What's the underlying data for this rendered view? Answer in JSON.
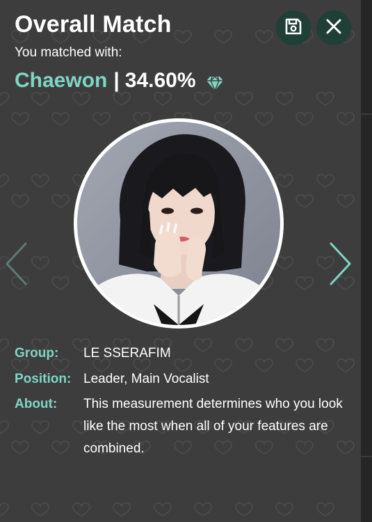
{
  "header": {
    "title": "Overall Match",
    "subtitle": "You matched with:"
  },
  "match": {
    "name": "Chaewon",
    "separator": "|",
    "percent": "34.60%",
    "gem_icon": "diamond-icon"
  },
  "toolbar": {
    "save_icon": "save-icon",
    "close_icon": "close-icon"
  },
  "navigation": {
    "prev_icon": "chevron-left-icon",
    "next_icon": "chevron-right-icon"
  },
  "profile": {
    "photo_alt": "Chaewon"
  },
  "details": {
    "group_label": "Group:",
    "group_value": "LE SSERAFIM",
    "position_label": "Position:",
    "position_value": "Leader, Main Vocalist",
    "about_label": "About:",
    "about_value": "This measurement determines who you look like the most when all of your features are combined."
  },
  "colors": {
    "accent": "#7fd6c4",
    "panel_background": "#3d3d3d",
    "button_background": "#1f3f37",
    "text": "#ffffff"
  }
}
